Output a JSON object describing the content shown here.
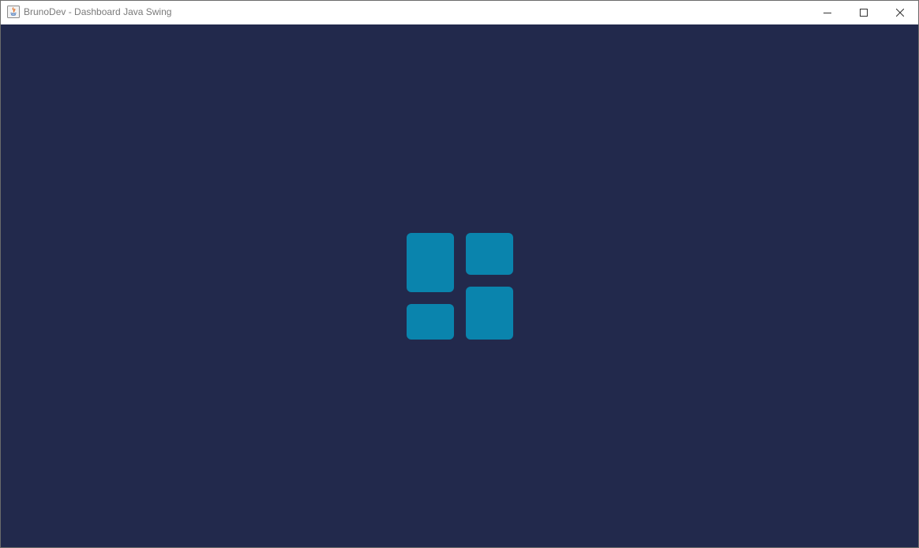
{
  "window": {
    "title": "BrunoDev - Dashboard Java Swing",
    "controls": {
      "minimize_icon": "minimize-icon",
      "maximize_icon": "maximize-icon",
      "close_icon": "close-icon"
    }
  },
  "theme": {
    "background": "#22294c",
    "logo_color": "#0a84ad",
    "titlebar_bg": "#ffffff",
    "title_color": "#7a7a7a"
  },
  "content": {
    "logo_icon": "dashboard-tiles-icon"
  }
}
